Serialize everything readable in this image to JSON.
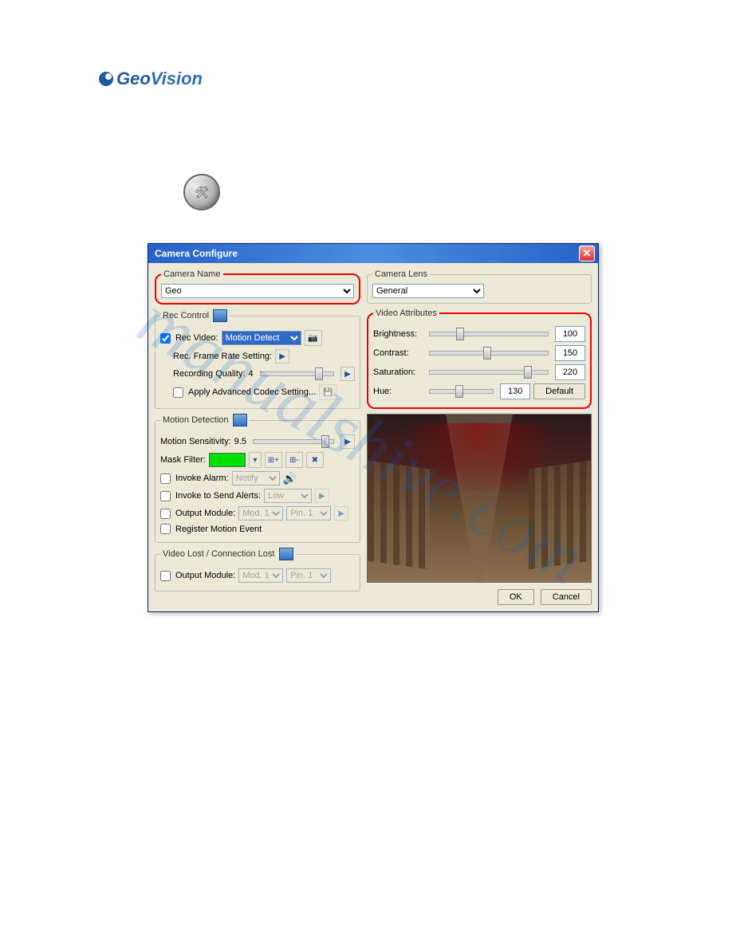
{
  "brand": {
    "geo": "Geo",
    "vision": "Vision"
  },
  "dialog": {
    "title": "Camera Configure",
    "camera_name": {
      "legend": "Camera Name",
      "value": "Geo"
    },
    "camera_lens": {
      "legend": "Camera Lens",
      "value": "General"
    },
    "rec_control": {
      "legend": "Rec Control",
      "rec_video": "Rec Video:",
      "rec_video_sel": "Motion Detect",
      "frame_rate": "Rec. Frame Rate Setting:",
      "recording_quality": "Recording Quality:",
      "recording_quality_val": "4",
      "apply_codec": "Apply Advanced Codec Setting..."
    },
    "motion": {
      "legend": "Motion Detection",
      "sensitivity": "Motion Sensitivity:",
      "sensitivity_val": "9.5",
      "mask_filter": "Mask Filter:",
      "invoke_alarm": "Invoke Alarm:",
      "invoke_alarm_sel": "Notify",
      "invoke_send": "Invoke to Send Alerts:",
      "invoke_send_sel": "Low",
      "output_module": "Output Module:",
      "output_mod_sel": "Mod. 1",
      "output_pin_sel": "Pin. 1",
      "register_motion": "Register Motion Event"
    },
    "video_lost": {
      "legend": "Video Lost / Connection Lost",
      "output_module": "Output Module:",
      "output_mod_sel": "Mod. 1",
      "output_pin_sel": "Pin. 1"
    },
    "video_attrs": {
      "legend": "Video Attributes",
      "brightness": "Brightness:",
      "brightness_val": "100",
      "contrast": "Contrast:",
      "contrast_val": "150",
      "saturation": "Saturation:",
      "saturation_val": "220",
      "hue": "Hue:",
      "hue_val": "130",
      "default": "Default"
    },
    "buttons": {
      "ok": "OK",
      "cancel": "Cancel"
    }
  }
}
